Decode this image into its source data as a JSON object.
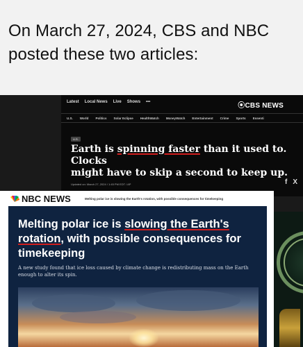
{
  "caption": "On March 27, 2024, CBS and NBC posted these two articles:",
  "cbs": {
    "brand": "⦿CBS NEWS",
    "nav": [
      "Latest",
      "Local News",
      "Live",
      "Shows",
      "•••"
    ],
    "subnav": [
      "U.S.",
      "World",
      "Politics",
      "Solar Eclipse",
      "HealthWatch",
      "MoneyWatch",
      "Entertainment",
      "Crime",
      "Sports",
      "Essenti"
    ],
    "tag": "U.S.",
    "headline_pre": "Earth is ",
    "headline_underlined": "spinning faster",
    "headline_post": " than it used to. Clocks\nmight have to skip a second to keep up.",
    "date": "Updated on: March 27, 2024 / 1:45 PM EDT / AP",
    "social": [
      "f",
      "X"
    ]
  },
  "nbc": {
    "brand": "NBC NEWS",
    "topline": "Melting polar ice is slowing the Earth's rotation, with possible consequences for timekeeping",
    "headline_pre": "Melting polar ice is ",
    "headline_underlined_1": "slowing the Earth's",
    "headline_underlined_2": "rotation",
    "headline_post": ", with possible consequences for timekeeping",
    "dek": "A new study found that ice loss caused by climate change is redistributing mass on the Earth enough to alter its spin."
  },
  "colors": {
    "underline": "#d21e1e",
    "nbc_navy": "#0f2340",
    "cbs_black": "#0a0a0a"
  }
}
